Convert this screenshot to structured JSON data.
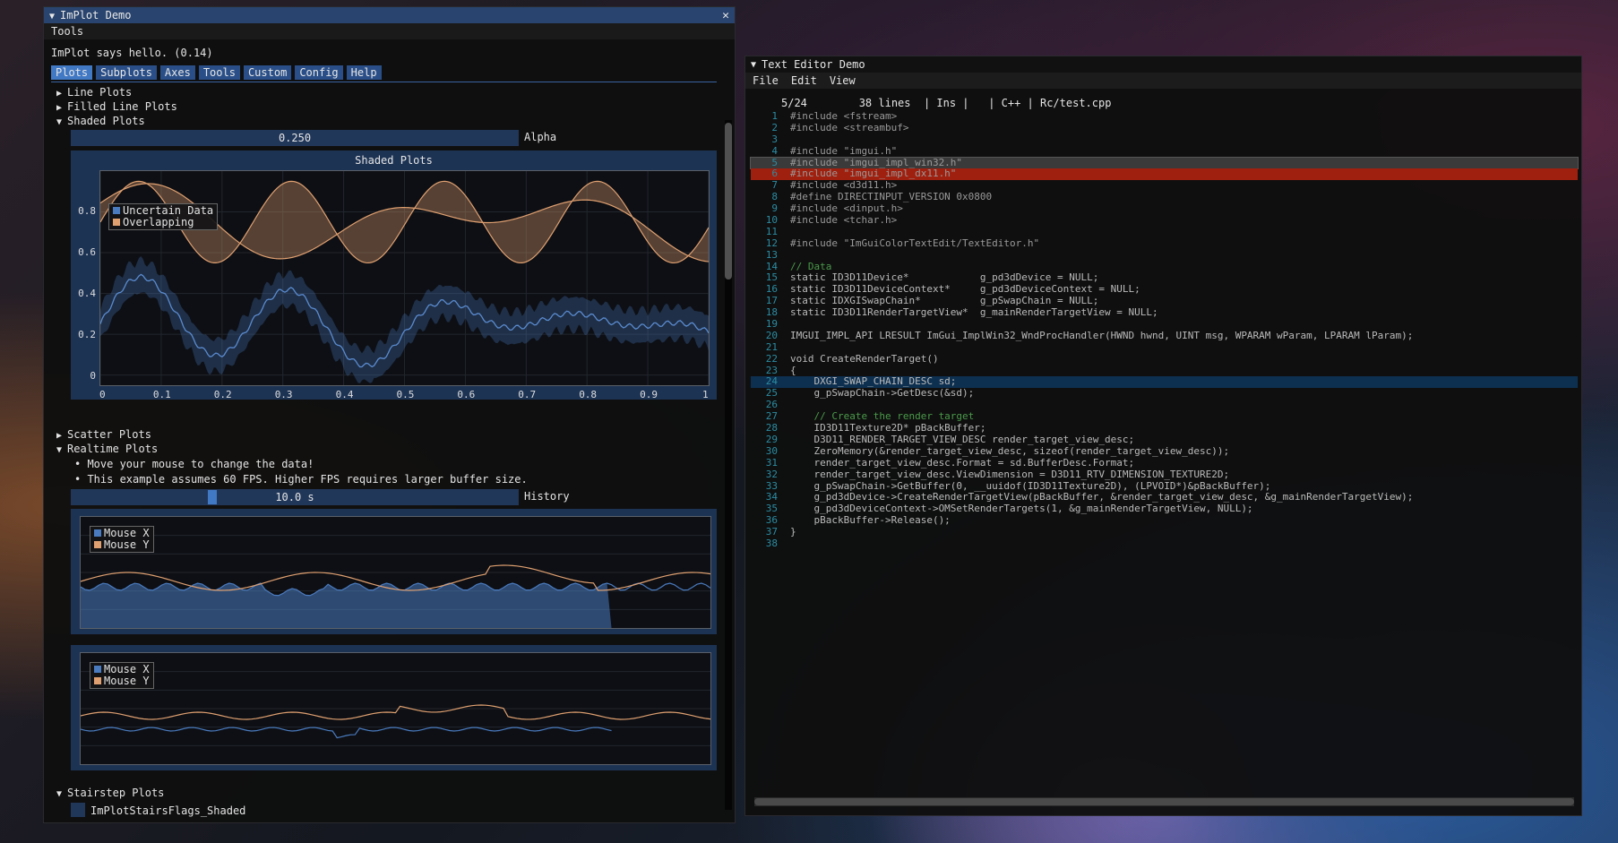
{
  "implot": {
    "title": "ImPlot Demo",
    "menu": [
      "Tools"
    ],
    "hello": "ImPlot says hello. (0.14)",
    "tabs": [
      "Plots",
      "Subplots",
      "Axes",
      "Tools",
      "Custom",
      "Config",
      "Help"
    ],
    "tree": {
      "line_plots": "Line Plots",
      "filled_line_plots": "Filled Line Plots",
      "shaded_plots": "Shaded Plots",
      "scatter_plots": "Scatter Plots",
      "realtime_plots": "Realtime Plots",
      "stairstep_plots": "Stairstep Plots"
    },
    "alpha_slider": {
      "value": "0.250",
      "label": "Alpha"
    },
    "shaded_chart": {
      "title": "Shaded Plots",
      "legend": [
        "Uncertain Data",
        "Overlapping"
      ],
      "y_ticks": [
        "0.8",
        "0.6",
        "0.4",
        "0.2",
        "0"
      ],
      "x_ticks": [
        "0",
        "0.1",
        "0.2",
        "0.3",
        "0.4",
        "0.5",
        "0.6",
        "0.7",
        "0.8",
        "0.9",
        "1"
      ]
    },
    "realtime_bullets": [
      "Move your mouse to change the data!",
      "This example assumes 60 FPS. Higher FPS requires larger buffer size."
    ],
    "history_slider": {
      "value": "10.0 s",
      "label": "History"
    },
    "realtime_legend": [
      "Mouse X",
      "Mouse Y"
    ],
    "stairs_flag": "ImPlotStairsFlags_Shaded"
  },
  "chart_data": {
    "type": "area",
    "title": "Shaded Plots",
    "x_range": [
      0,
      1
    ],
    "y_range": [
      -0.05,
      1.0
    ],
    "legend": "top-left",
    "series": [
      {
        "name": "Uncertain Data",
        "color": "#4a7bbf",
        "kind": "line with shaded band",
        "approx_y_min": 0.05,
        "approx_y_max": 0.52
      },
      {
        "name": "Overlapping",
        "color": "#e0a070",
        "kind": "two lines with shaded fill",
        "approx_y_min": 0.55,
        "approx_y_max": 0.95
      }
    ]
  },
  "editor": {
    "title": "Text Editor Demo",
    "menu": [
      "File",
      "Edit",
      "View"
    ],
    "status": "5/24        38 lines  | Ins |   | C++ | Rc/test.cpp",
    "lines": [
      "#include <fstream>",
      "#include <streambuf>",
      "",
      "#include \"imgui.h\"",
      "#include \"imgui_impl_win32.h\"",
      "#include \"imgui_impl_dx11.h\"",
      "#include <d3d11.h>",
      "#define DIRECTINPUT_VERSION 0x0800",
      "#include <dinput.h>",
      "#include <tchar.h>",
      "",
      "#include \"ImGuiColorTextEdit/TextEditor.h\"",
      "",
      "// Data",
      "static ID3D11Device*            g_pd3dDevice = NULL;",
      "static ID3D11DeviceContext*     g_pd3dDeviceContext = NULL;",
      "static IDXGISwapChain*          g_pSwapChain = NULL;",
      "static ID3D11RenderTargetView*  g_mainRenderTargetView = NULL;",
      "",
      "IMGUI_IMPL_API LRESULT ImGui_ImplWin32_WndProcHandler(HWND hwnd, UINT msg, WPARAM wParam, LPARAM lParam);",
      "",
      "void CreateRenderTarget()",
      "{",
      "    DXGI_SWAP_CHAIN_DESC sd;",
      "    g_pSwapChain->GetDesc(&sd);",
      "",
      "    // Create the render target",
      "    ID3D11Texture2D* pBackBuffer;",
      "    D3D11_RENDER_TARGET_VIEW_DESC render_target_view_desc;",
      "    ZeroMemory(&render_target_view_desc, sizeof(render_target_view_desc));",
      "    render_target_view_desc.Format = sd.BufferDesc.Format;",
      "    render_target_view_desc.ViewDimension = D3D11_RTV_DIMENSION_TEXTURE2D;",
      "    g_pSwapChain->GetBuffer(0, __uuidof(ID3D11Texture2D), (LPVOID*)&pBackBuffer);",
      "    g_pd3dDevice->CreateRenderTargetView(pBackBuffer, &render_target_view_desc, &g_mainRenderTargetView);",
      "    g_pd3dDeviceContext->OMSetRenderTargets(1, &g_mainRenderTargetView, NULL);",
      "    pBackBuffer->Release();",
      "}",
      ""
    ]
  }
}
